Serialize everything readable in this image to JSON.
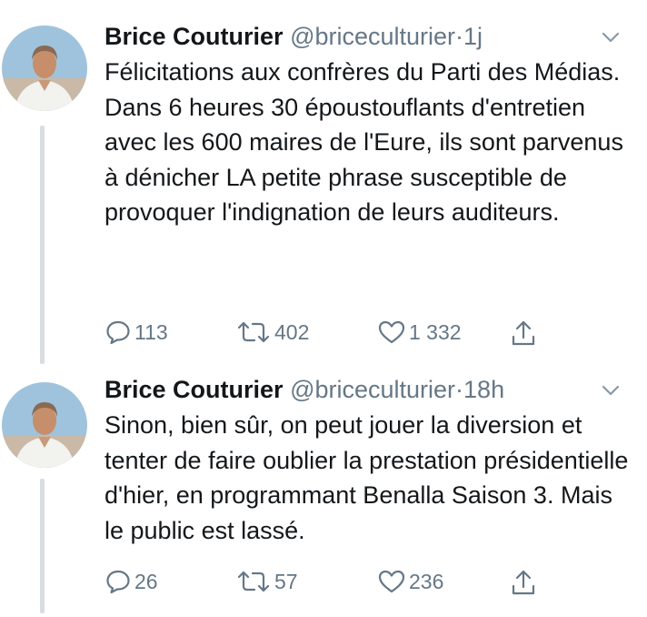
{
  "tweets": [
    {
      "author_name": "Brice Couturier",
      "handle": "@briceculturier",
      "separator": "·",
      "time": "1j",
      "text": "Félicitations aux confrères du Parti des Médias. Dans 6 heures 30 époustouflants d'entretien avec les  600 maires de l'Eure, ils sont parvenus à dénicher LA petite phrase susceptible de provoquer l'indignation de leurs auditeurs.",
      "replies": "113",
      "retweets": "402",
      "likes": "1 332"
    },
    {
      "author_name": "Brice Couturier",
      "handle": "@briceculturier",
      "separator": "·",
      "time": "18h",
      "text": "Sinon, bien sûr, on peut jouer la diversion et tenter de faire oublier la prestation présidentielle d'hier, en programmant Benalla Saison 3. Mais le public est lassé.",
      "replies": "26",
      "retweets": "57",
      "likes": "236"
    }
  ],
  "icons": {
    "reply": "reply-icon",
    "retweet": "retweet-icon",
    "like": "heart-icon",
    "share": "share-icon",
    "menu": "chevron-down-icon"
  },
  "colors": {
    "text": "#14171a",
    "secondary": "#657786",
    "thread_line": "#d8dde2"
  }
}
